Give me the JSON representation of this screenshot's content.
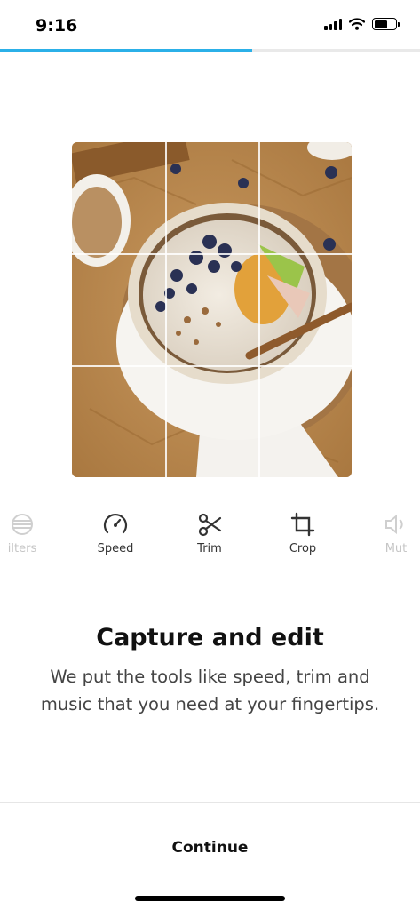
{
  "status_bar": {
    "time": "9:16"
  },
  "progress": {
    "fraction": 0.6,
    "color": "#2bb0e8"
  },
  "tools": [
    {
      "id": "filters",
      "label": "ilters",
      "icon": "filters-icon"
    },
    {
      "id": "speed",
      "label": "Speed",
      "icon": "speedometer-icon"
    },
    {
      "id": "trim",
      "label": "Trim",
      "icon": "scissors-icon"
    },
    {
      "id": "crop",
      "label": "Crop",
      "icon": "crop-icon"
    },
    {
      "id": "mute",
      "label": "Mut",
      "icon": "speaker-icon"
    }
  ],
  "headline": "Capture and edit",
  "subtext": "We put the tools like speed, trim and music that you need at your fingertips.",
  "continue_label": "Continue"
}
